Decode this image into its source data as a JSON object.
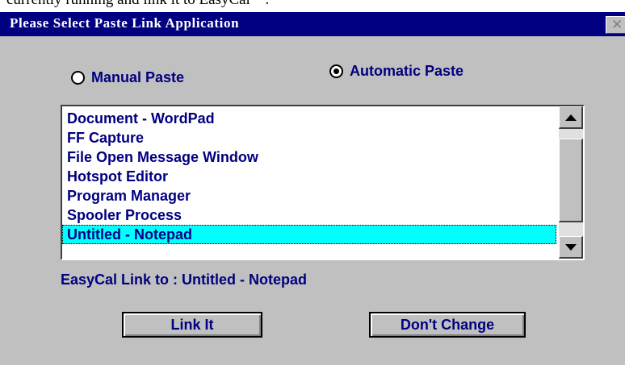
{
  "above_text": "currently running and link it to EasyCal™.",
  "dialog": {
    "title": "Please Select Paste Link Application",
    "close_symbol": "✕",
    "close_icon": "close-icon"
  },
  "paste_mode": {
    "manual_label": "Manual Paste",
    "automatic_label": "Automatic Paste",
    "selected": "automatic"
  },
  "applications": {
    "items": [
      "Document - WordPad",
      "FF Capture",
      "File Open Message Window",
      "Hotspot Editor",
      "Program Manager",
      "Spooler Process",
      "Untitled - Notepad"
    ],
    "selected_index": 6
  },
  "link_status": "EasyCal Link to : Untitled - Notepad",
  "buttons": {
    "link_it": "Link It",
    "dont_change": "Don't Change"
  },
  "colors": {
    "title_bar": "#000080",
    "text": "#000080",
    "selection": "#00ffff",
    "face": "#c0c0c0"
  }
}
